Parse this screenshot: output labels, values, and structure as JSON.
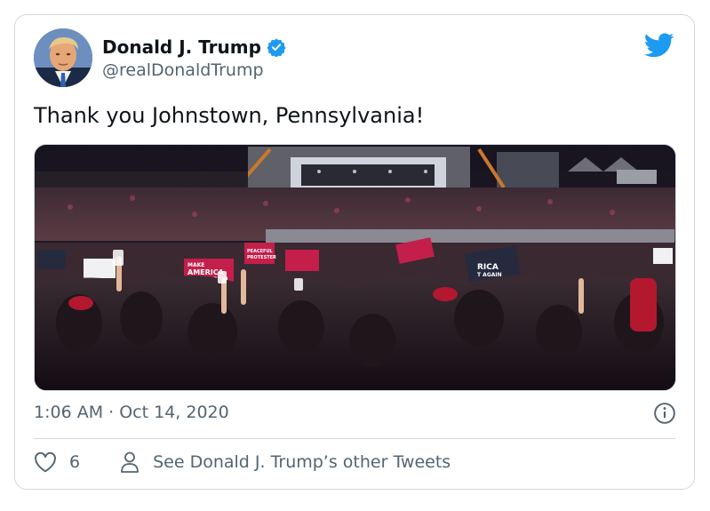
{
  "tweet": {
    "author": {
      "display_name": "Donald J. Trump",
      "handle": "@realDonaldTrump",
      "verified": true,
      "avatar_icon": "profile-photo"
    },
    "text": "Thank you Johnstown, Pennsylvania!",
    "media": {
      "type": "photo",
      "sign_texts": [
        "MAKE AMERICA GREAT AGAIN",
        "PEACEFUL PROTESTER",
        "MAKE AMERICA GREAT AGAIN",
        "MAKE AMERICA GREAT AGAIN"
      ]
    },
    "timestamp": "1:06 AM · Oct 14, 2020",
    "likes": "6",
    "other_tweets_label": "See Donald J. Trump’s other Tweets"
  },
  "icons": {
    "brand": "twitter-bird-icon",
    "verified": "verified-badge-icon",
    "info": "info-icon",
    "like": "heart-icon",
    "profile": "person-icon"
  },
  "colors": {
    "brand_blue": "#1d9bf0",
    "text_primary": "#0f1419",
    "text_secondary": "#536471",
    "border": "#cfd9de"
  }
}
